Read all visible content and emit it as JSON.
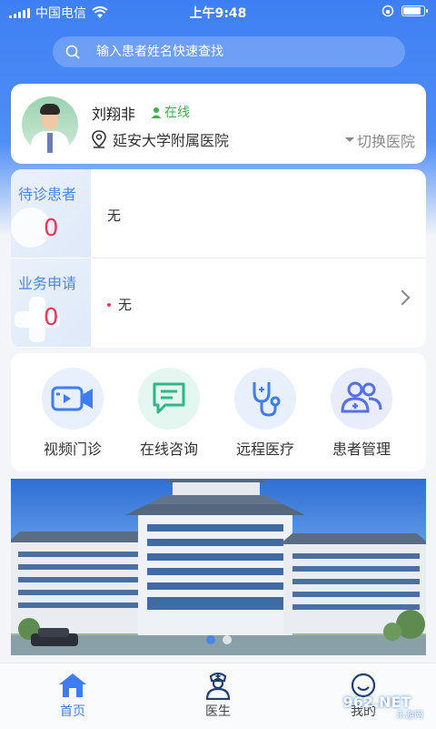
{
  "status_bar": {
    "carrier": "中国电信",
    "time": "上午9:48"
  },
  "search": {
    "placeholder": "输入患者姓名快速查找"
  },
  "profile": {
    "name": "刘翔非",
    "status": "在线",
    "hospital": "延安大学附属医院",
    "switch_label": "切换医院"
  },
  "tasks": [
    {
      "label": "待诊患者",
      "count": "0",
      "content": "无"
    },
    {
      "label": "业务申请",
      "count": "0",
      "content": "无"
    }
  ],
  "quick_actions": [
    {
      "label": "视频门诊",
      "icon": "video-camera-icon"
    },
    {
      "label": "在线咨询",
      "icon": "chat-bubble-icon"
    },
    {
      "label": "远程医疗",
      "icon": "stethoscope-icon"
    },
    {
      "label": "患者管理",
      "icon": "patients-group-icon"
    }
  ],
  "banner": {
    "slide_count": 2,
    "active_slide": 1
  },
  "tabbar": [
    {
      "label": "首页",
      "icon": "home-icon",
      "active": true
    },
    {
      "label": "医生",
      "icon": "doctor-icon",
      "active": false
    },
    {
      "label": "我的",
      "icon": "profile-icon",
      "active": false
    }
  ],
  "watermark": {
    "text": "962.NET",
    "sub": "乐游网"
  },
  "colors": {
    "accent": "#4a86e8",
    "online": "#3ab24b",
    "badge": "#e83a5a"
  }
}
